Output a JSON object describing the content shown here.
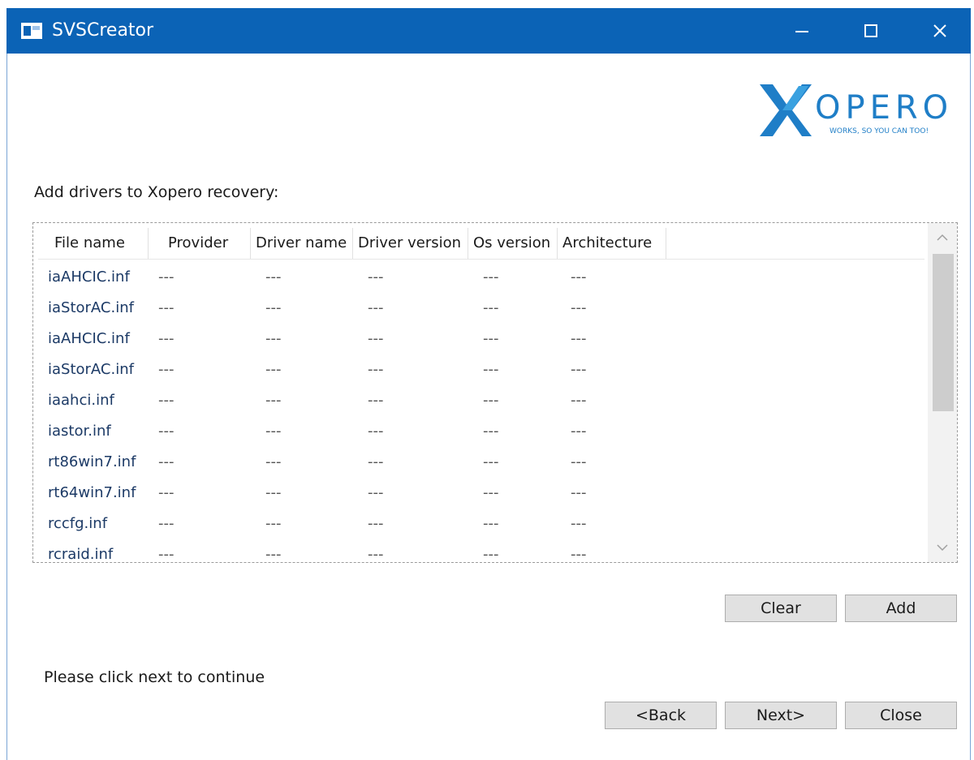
{
  "window": {
    "title": "SVSCreator",
    "controls": [
      "minimize",
      "maximize",
      "close"
    ],
    "accent_color": "#0b63b6"
  },
  "logo": {
    "brand": "XOPERO",
    "tagline": "WORKS, SO YOU CAN TOO!"
  },
  "main": {
    "section_label": "Add drivers to Xopero recovery:",
    "table": {
      "columns": [
        "File name",
        "Provider",
        "Driver name",
        "Driver version",
        "Os version",
        "Architecture"
      ],
      "rows": [
        [
          "iaAHCIC.inf",
          "---",
          "---",
          "---",
          "---",
          "---"
        ],
        [
          "iaStorAC.inf",
          "---",
          "---",
          "---",
          "---",
          "---"
        ],
        [
          "iaAHCIC.inf",
          "---",
          "---",
          "---",
          "---",
          "---"
        ],
        [
          "iaStorAC.inf",
          "---",
          "---",
          "---",
          "---",
          "---"
        ],
        [
          "iaahci.inf",
          "---",
          "---",
          "---",
          "---",
          "---"
        ],
        [
          "iastor.inf",
          "---",
          "---",
          "---",
          "---",
          "---"
        ],
        [
          "rt86win7.inf",
          "---",
          "---",
          "---",
          "---",
          "---"
        ],
        [
          "rt64win7.inf",
          "---",
          "---",
          "---",
          "---",
          "---"
        ],
        [
          "rccfg.inf",
          "---",
          "---",
          "---",
          "---",
          "---"
        ],
        [
          "rcraid.inf",
          "---",
          "---",
          "---",
          "---",
          "---"
        ]
      ]
    },
    "buttons": {
      "clear": "Clear",
      "add": "Add"
    },
    "status_text": "Please click next to continue"
  },
  "footer": {
    "back": "<Back",
    "next": "Next>",
    "close": "Close"
  }
}
